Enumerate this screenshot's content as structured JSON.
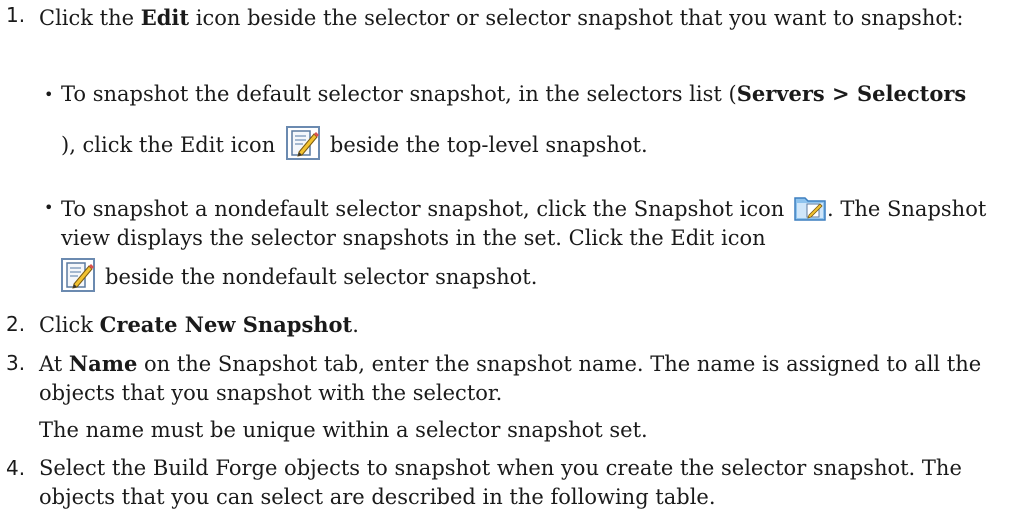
{
  "steps": [
    {
      "number": "1.",
      "pre": "Click the ",
      "bold": "Edit",
      "post": " icon beside the selector or selector snapshot that you want to snapshot:",
      "bullets": [
        {
          "pre": "To snapshot the default selector snapshot, in the selectors list (",
          "bold": "Servers > Selectors",
          "mid": "), click the Edit icon",
          "post": "beside the top-level snapshot."
        },
        {
          "pre": "To snapshot a nondefault selector snapshot, click the Snapshot icon",
          "mid": ". The Snapshot view displays the selector snapshots in the set. Click the Edit icon",
          "post": "beside the nondefault selector snapshot."
        }
      ]
    },
    {
      "number": "2.",
      "pre": "Click ",
      "bold": "Create New Snapshot",
      "post": "."
    },
    {
      "number": "3.",
      "pre": "At ",
      "bold": "Name",
      "post": " on the Snapshot tab, enter the snapshot name. The name is assigned to all the objects that you snapshot with the selector.",
      "extra": "The name must be unique within a selector snapshot set."
    },
    {
      "number": "4.",
      "text": "Select the Build Forge objects to snapshot when you create the selector snapshot. The objects that you can select are described in the following table."
    }
  ],
  "icons": [
    "edit-icon",
    "snapshot-icon",
    "edit-icon"
  ]
}
